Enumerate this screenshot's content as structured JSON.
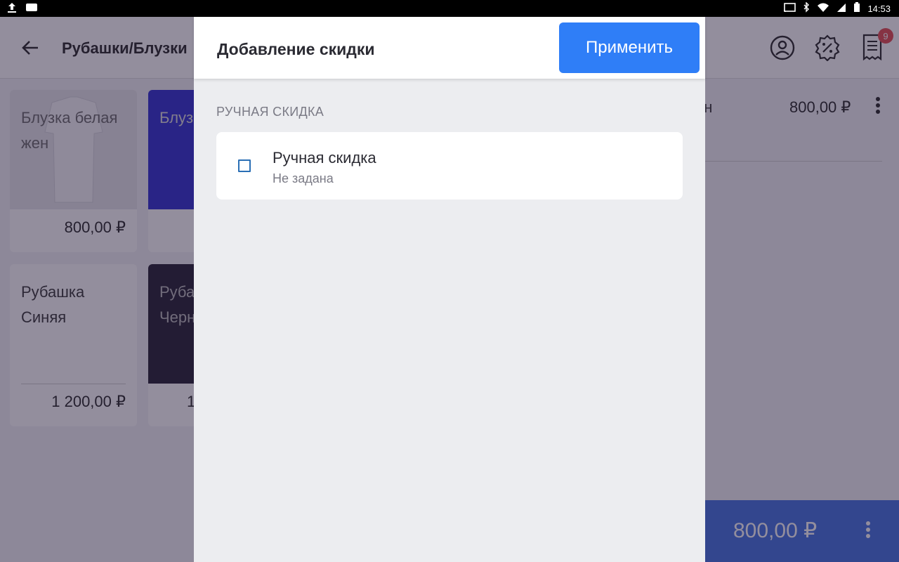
{
  "status_bar": {
    "time": "14:53"
  },
  "background": {
    "breadcrumb": "Рубашки/Блузки",
    "notification_count": "9",
    "products": [
      {
        "name": "Блузка белая жен",
        "price": "800,00 ₽"
      },
      {
        "name": "Блузка синяя",
        "price": ""
      },
      {
        "name": "Рубашка Синяя",
        "price": "1 200,00 ₽"
      },
      {
        "name": "Рубашка Черная",
        "price": "1"
      }
    ],
    "cart_item": {
      "name": "ен",
      "price": "800,00 ₽"
    },
    "total": "800,00 ₽"
  },
  "dialog": {
    "title": "Добавление скидки",
    "apply_label": "Применить",
    "section_label": "РУЧНАЯ СКИДКА",
    "item": {
      "title": "Ручная скидка",
      "subtitle": "Не задана",
      "checked": false
    }
  },
  "colors": {
    "accent": "#2f7ef7",
    "checkbox": "#2a6fb5",
    "badge": "#e5484d"
  }
}
